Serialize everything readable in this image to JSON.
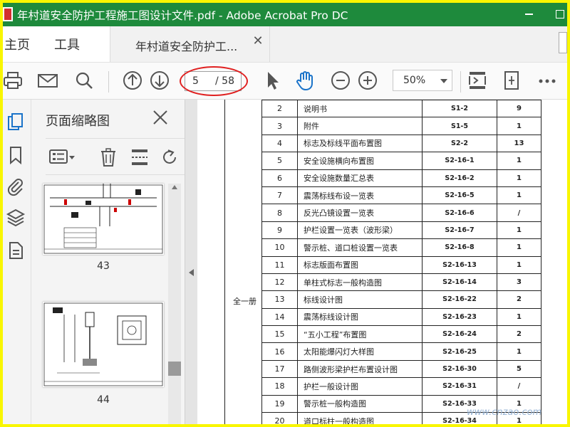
{
  "window": {
    "title": "年村道安全防护工程施工图设计文件.pdf - Adobe Acrobat Pro DC",
    "accent": "#1e8a3c"
  },
  "tabs": {
    "home": "主页",
    "tools": "工具",
    "document": "年村道安全防护工..."
  },
  "toolbar": {
    "page_current": "5",
    "page_total": "/ 58",
    "zoom": "50%",
    "icons": [
      "print-icon",
      "email-icon",
      "search-icon",
      "prev-page-icon",
      "next-page-icon",
      "select-cursor-icon",
      "hand-tool-icon",
      "zoom-out-icon",
      "zoom-in-icon",
      "fit-page-icon",
      "rotate-view-icon",
      "more-icon"
    ]
  },
  "thumbnails": {
    "title": "页面缩略图",
    "pages": [
      "43",
      "44"
    ]
  },
  "document": {
    "volume_label": "全一册",
    "rows": [
      {
        "idx": "2",
        "name": "说明书",
        "code": "S1-2",
        "pages": "9"
      },
      {
        "idx": "3",
        "name": "附件",
        "code": "S1-5",
        "pages": "1"
      },
      {
        "idx": "4",
        "name": "标志及标线平面布置图",
        "code": "S2-2",
        "pages": "13"
      },
      {
        "idx": "5",
        "name": "安全设施横向布置图",
        "code": "S2-16-1",
        "pages": "1"
      },
      {
        "idx": "6",
        "name": "安全设施数量汇总表",
        "code": "S2-16-2",
        "pages": "1"
      },
      {
        "idx": "7",
        "name": "震荡标线布设一览表",
        "code": "S2-16-5",
        "pages": "1"
      },
      {
        "idx": "8",
        "name": "反光凸镜设置一览表",
        "code": "S2-16-6",
        "pages": "/"
      },
      {
        "idx": "9",
        "name": "护栏设置一览表（波形梁）",
        "code": "S2-16-7",
        "pages": "1"
      },
      {
        "idx": "10",
        "name": "警示桩、道口桩设置一览表",
        "code": "S2-16-8",
        "pages": "1"
      },
      {
        "idx": "11",
        "name": "标志版面布置图",
        "code": "S2-16-13",
        "pages": "1"
      },
      {
        "idx": "12",
        "name": "单柱式标志一般构造图",
        "code": "S2-16-14",
        "pages": "3"
      },
      {
        "idx": "13",
        "name": "标线设计图",
        "code": "S2-16-22",
        "pages": "2"
      },
      {
        "idx": "14",
        "name": "震荡标线设计图",
        "code": "S2-16-23",
        "pages": "1"
      },
      {
        "idx": "15",
        "name": "“五小工程”布置图",
        "code": "S2-16-24",
        "pages": "2"
      },
      {
        "idx": "16",
        "name": "太阳能爆闪灯大样图",
        "code": "S2-16-25",
        "pages": "1"
      },
      {
        "idx": "17",
        "name": "路侧波形梁护栏布置设计图",
        "code": "S2-16-30",
        "pages": "5"
      },
      {
        "idx": "18",
        "name": "护栏一般设计图",
        "code": "S2-16-31",
        "pages": "/"
      },
      {
        "idx": "19",
        "name": "警示桩一般构造图",
        "code": "S2-16-33",
        "pages": "1"
      },
      {
        "idx": "20",
        "name": "道口标柱一般构造图",
        "code": "S2-16-34",
        "pages": "1"
      }
    ]
  },
  "watermark": "www.cnzao.com"
}
